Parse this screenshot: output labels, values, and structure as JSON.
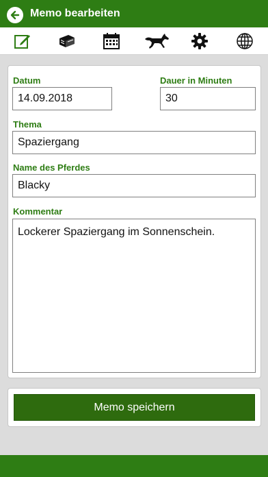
{
  "header": {
    "title": "Memo bearbeiten"
  },
  "toolbar": {
    "icons": [
      "edit-icon",
      "money-icon",
      "calendar-icon",
      "horse-icon",
      "gear-icon",
      "globe-icon"
    ],
    "accent": "#2e7d14"
  },
  "form": {
    "date_label": "Datum",
    "date_value": "14.09.2018",
    "duration_label": "Dauer in Minuten",
    "duration_value": "30",
    "topic_label": "Thema",
    "topic_value": "Spaziergang",
    "horse_label": "Name des Pferdes",
    "horse_value": "Blacky",
    "comment_label": "Kommentar",
    "comment_value": "Lockerer Spaziergang im Sonnenschein."
  },
  "actions": {
    "save_label": "Memo speichern"
  },
  "colors": {
    "brand": "#2e7d14",
    "button": "#2e6b0e",
    "background": "#dcdcdc"
  }
}
